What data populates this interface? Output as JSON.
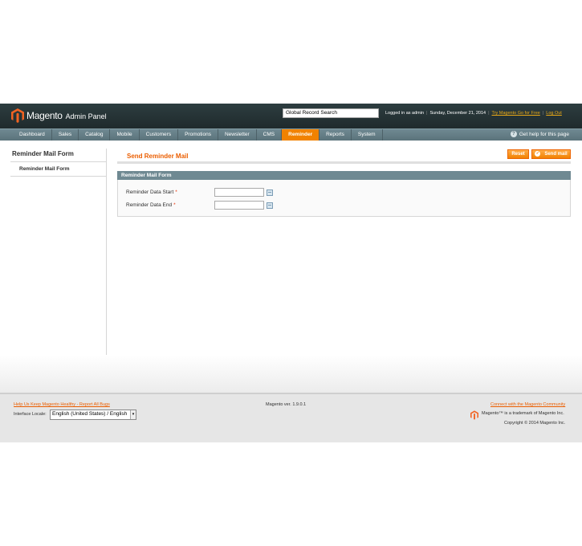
{
  "header": {
    "logo_text": "Magento",
    "logo_sub": "Admin Panel",
    "search_value": "Global Record Search",
    "logged_in": "Logged in as admin",
    "date": "Sunday, December 21, 2014",
    "try_link": "Try Magento Go for Free",
    "logout_link": "Log Out"
  },
  "nav": {
    "items": [
      "Dashboard",
      "Sales",
      "Catalog",
      "Mobile",
      "Customers",
      "Promotions",
      "Newsletter",
      "CMS",
      "Reminder",
      "Reports",
      "System"
    ],
    "active": "Reminder",
    "help": "Get help for this page"
  },
  "sidebar": {
    "title": "Reminder Mail Form",
    "tab": "Reminder Mail Form"
  },
  "content": {
    "title": "Send Reminder Mail",
    "reset_label": "Reset",
    "send_label": "Send mail",
    "fieldset_legend": "Reminder Mail Form",
    "fields": [
      {
        "label": "Reminder Data Start",
        "required": "*",
        "value": ""
      },
      {
        "label": "Reminder Data End",
        "required": "*",
        "value": ""
      }
    ]
  },
  "footer": {
    "bug_link": "Help Us Keep Magento Healthy - Report All Bugs",
    "version": "Magento ver. 1.9.0.1",
    "community_link": "Connect with the Magento Community",
    "locale_label": "Interface Locale:",
    "locale_value": "English (United States) / English",
    "trademark": "Magento™ is a trademark of Magento Inc.",
    "copyright": "Copyright © 2014 Magento Inc."
  },
  "colors": {
    "accent": "#f18200",
    "header_bg": "#2d3d40",
    "nav_bg": "#6f8992",
    "title_orange": "#eb5e00"
  }
}
